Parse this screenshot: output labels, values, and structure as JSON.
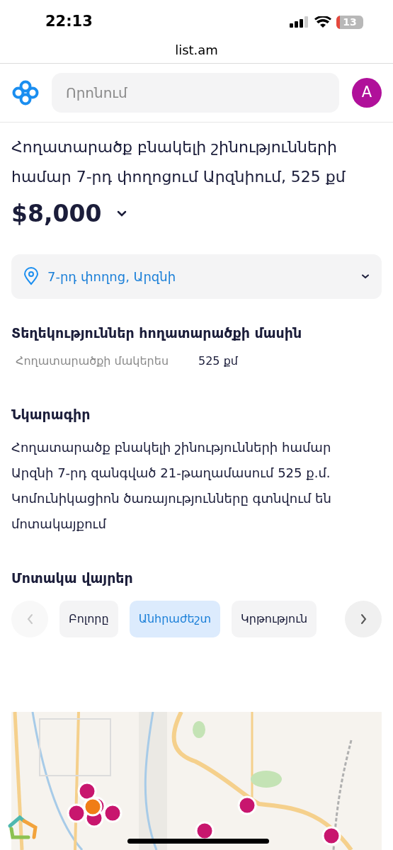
{
  "status_bar": {
    "time": "22:13",
    "battery": "13"
  },
  "browser": {
    "url": "list.am"
  },
  "header": {
    "search": {
      "placeholder": "Որոնում"
    },
    "avatar": "A"
  },
  "listing": {
    "title": "Հողատարածք բնակելի շինությունների համար 7-րդ փողոցում Արզնիում, 525 քմ",
    "price": "$8,000",
    "location": "7-րդ փողոց, Արզնի"
  },
  "details": {
    "heading": "Տեղեկություններ հողատարածքի մասին",
    "rows": [
      {
        "label": "Հողատարածքի մակերես",
        "value": "525 քմ"
      }
    ]
  },
  "description": {
    "heading": "Նկարագիր",
    "paragraphs": [
      "Հողատարածք բնակելի շինությունների համար Արզնի 7-րդ զանգված 21-թաղամասում 525 ք.մ.",
      "Կոմունիկացիոն ծառայությունները գտնվում են մոտակայքում"
    ]
  },
  "nearby": {
    "heading": "Մոտակա վայրեր",
    "nav": [
      {
        "kind": "prev",
        "disabled": true
      },
      {
        "kind": "next",
        "disabled": false
      }
    ],
    "tabs": [
      {
        "label": "Բոլորը",
        "selected": false
      },
      {
        "label": "Անհրաժեշտ",
        "selected": true
      },
      {
        "label": "Կրթություն",
        "selected": false
      }
    ]
  }
}
